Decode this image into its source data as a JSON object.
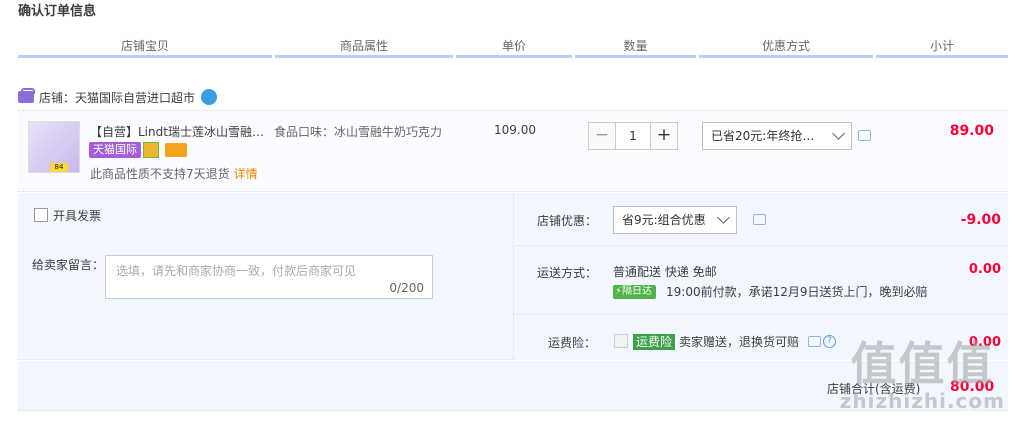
{
  "page_title": "确认订单信息",
  "headers": [
    "店铺宝贝",
    "商品属性",
    "单价",
    "数量",
    "优惠方式",
    "小计"
  ],
  "shop": {
    "label": "店铺：天猫国际自营进口超市"
  },
  "item": {
    "title": "【自营】Lindt瑞士莲冰山雪融…",
    "tag": "天猫国际",
    "thumb_badge": "84",
    "no_return": "此商品性质不支持7天退货",
    "detail_link": "详情",
    "attribute": "食品口味：冰山雪融牛奶巧克力",
    "price": "109.00",
    "quantity": "1",
    "promo": "已省20元:年终抢…",
    "subtotal": "89.00"
  },
  "invoice_label": "开具发票",
  "memo": {
    "label": "给卖家留言：",
    "placeholder": "选填，请先和商家协商一致，付款后商家可见",
    "count": "0/200"
  },
  "store_discount": {
    "label": "店铺优惠：",
    "option": "省9元:组合优惠",
    "amount": "-9.00"
  },
  "shipping": {
    "label": "运送方式：",
    "method": "普通配送 快递 免邮",
    "badge": "隔日达",
    "eta": "19:00前付款，承诺12月9日送货上门，晚到必赔",
    "amount": "0.00"
  },
  "insurance": {
    "label": "运费险：",
    "badge": "运费险",
    "desc": "卖家赠送，退换货可赔",
    "amount": "0.00"
  },
  "total": {
    "label": "店铺合计(含运费)",
    "amount": "80.00"
  },
  "watermark": {
    "big": "值值值",
    "small": "zhizhizhi.com"
  },
  "colors": {
    "accent_red": "#ff0036",
    "header_underline": "#b2d1ff",
    "panel_bg": "#f2f7ff"
  }
}
